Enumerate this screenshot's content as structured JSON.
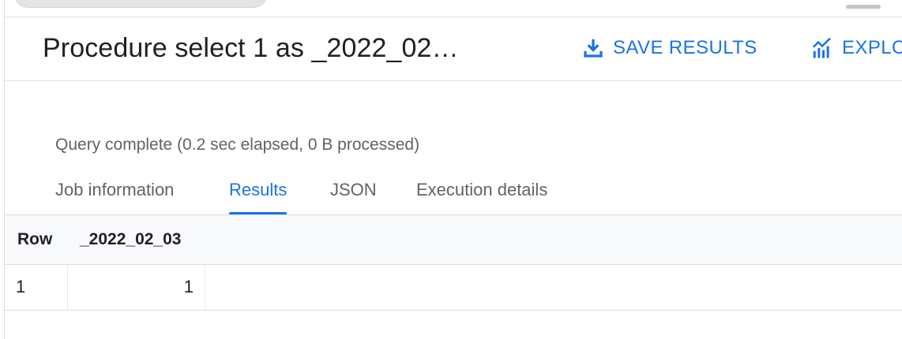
{
  "header": {
    "title": "Procedure select 1 as _2022_02…",
    "save_label": "SAVE RESULTS",
    "explore_label": "EXPLO"
  },
  "status": {
    "text": "Query complete (0.2 sec elapsed, 0 B processed)"
  },
  "tabs": [
    {
      "label": "Job information",
      "active": false
    },
    {
      "label": "Results",
      "active": true
    },
    {
      "label": "JSON",
      "active": false
    },
    {
      "label": "Execution details",
      "active": false
    }
  ],
  "table": {
    "columns": [
      "Row",
      "_2022_02_03"
    ],
    "rows": [
      {
        "row": "1",
        "value": "1"
      }
    ]
  },
  "colors": {
    "accent": "#1a73e8",
    "text": "#202124",
    "muted": "#5f6368",
    "divider": "#dadce0",
    "header_bg": "#f8f9fa"
  },
  "icons": {
    "save": "download-icon",
    "explore": "chart-icon"
  }
}
